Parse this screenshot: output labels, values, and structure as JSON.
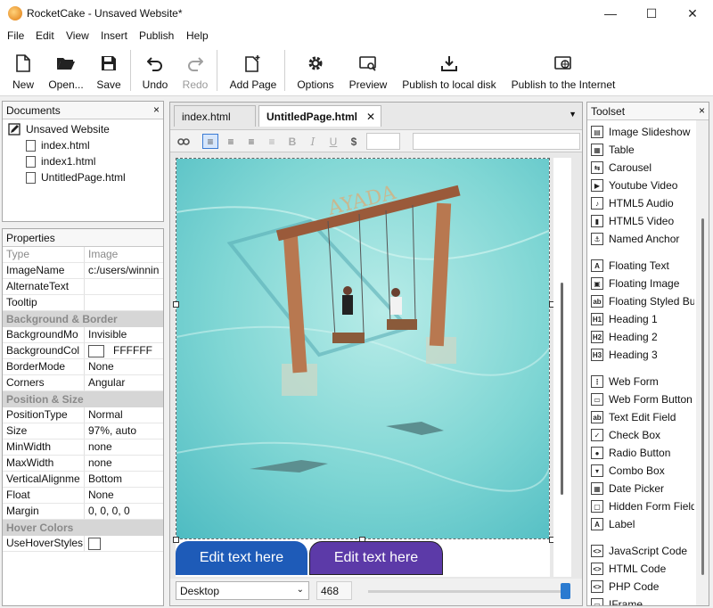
{
  "window": {
    "title": "RocketCake - Unsaved Website*",
    "minimize": "—",
    "maximize": "☐",
    "close": "✕"
  },
  "menu": [
    "File",
    "Edit",
    "View",
    "Insert",
    "Publish",
    "Help"
  ],
  "toolbar": {
    "new": "New",
    "open": "Open...",
    "save": "Save",
    "undo": "Undo",
    "redo": "Redo",
    "add_page": "Add Page",
    "options": "Options",
    "preview": "Preview",
    "publish_local": "Publish to local disk",
    "publish_internet": "Publish to the Internet"
  },
  "documents": {
    "title": "Documents",
    "close": "×",
    "root": "Unsaved Website",
    "files": [
      "index.html",
      "index1.html",
      "UntitledPage.html"
    ]
  },
  "properties": {
    "title": "Properties",
    "header": {
      "name": "Type",
      "value": "Image"
    },
    "rows": [
      {
        "kind": "prop",
        "name": "ImageName",
        "value": "c:/users/winnin"
      },
      {
        "kind": "prop",
        "name": "AlternateText",
        "value": ""
      },
      {
        "kind": "prop",
        "name": "Tooltip",
        "value": ""
      },
      {
        "kind": "cat",
        "name": "Background & Border"
      },
      {
        "kind": "prop",
        "name": "BackgroundMo",
        "value": "Invisible"
      },
      {
        "kind": "prop",
        "name": "BackgroundCol",
        "value": "FFFFFF",
        "swatch": "#ffffff"
      },
      {
        "kind": "prop",
        "name": "BorderMode",
        "value": "None"
      },
      {
        "kind": "prop",
        "name": "Corners",
        "value": "Angular"
      },
      {
        "kind": "cat",
        "name": "Position & Size"
      },
      {
        "kind": "prop",
        "name": "PositionType",
        "value": "Normal"
      },
      {
        "kind": "prop",
        "name": "Size",
        "value": "97%, auto"
      },
      {
        "kind": "prop",
        "name": "MinWidth",
        "value": "none"
      },
      {
        "kind": "prop",
        "name": "MaxWidth",
        "value": "none"
      },
      {
        "kind": "prop",
        "name": "VerticalAlignme",
        "value": "Bottom"
      },
      {
        "kind": "prop",
        "name": "Float",
        "value": "None"
      },
      {
        "kind": "prop",
        "name": "Margin",
        "value": "0, 0, 0, 0"
      },
      {
        "kind": "cat",
        "name": "Hover Colors"
      },
      {
        "kind": "prop",
        "name": "UseHoverStyles",
        "value": "",
        "checkbox": true
      }
    ]
  },
  "editor": {
    "tabs": [
      {
        "label": "index.html",
        "active": false
      },
      {
        "label": "UntitledPage.html",
        "active": true
      }
    ],
    "tab_close": "✕",
    "image_sign": "AYADA",
    "button1": "Edit text here",
    "button2": "Edit text here",
    "device": "Desktop",
    "width_value": "468",
    "colors": {
      "button1": "#1e5bb8",
      "button2": "#5c3aa8"
    }
  },
  "toolset": {
    "title": "Toolset",
    "close": "×",
    "groups": [
      [
        {
          "label": "Image Slideshow",
          "icon": "slideshow-icon"
        },
        {
          "label": "Table",
          "icon": "table-icon"
        },
        {
          "label": "Carousel",
          "icon": "carousel-icon"
        },
        {
          "label": "Youtube Video",
          "icon": "youtube-icon"
        },
        {
          "label": "HTML5 Audio",
          "icon": "audio-icon"
        },
        {
          "label": "HTML5 Video",
          "icon": "video-icon"
        },
        {
          "label": "Named Anchor",
          "icon": "anchor-icon"
        }
      ],
      [
        {
          "label": "Floating Text",
          "icon": "text-icon"
        },
        {
          "label": "Floating Image",
          "icon": "image-icon"
        },
        {
          "label": "Floating Styled But",
          "icon": "styled-button-icon"
        },
        {
          "label": "Heading 1",
          "icon": "h1-icon"
        },
        {
          "label": "Heading 2",
          "icon": "h2-icon"
        },
        {
          "label": "Heading 3",
          "icon": "h3-icon"
        }
      ],
      [
        {
          "label": "Web Form",
          "icon": "form-icon"
        },
        {
          "label": "Web Form Button",
          "icon": "form-button-icon"
        },
        {
          "label": "Text Edit Field",
          "icon": "text-field-icon"
        },
        {
          "label": "Check Box",
          "icon": "checkbox-icon"
        },
        {
          "label": "Radio Button",
          "icon": "radio-icon"
        },
        {
          "label": "Combo Box",
          "icon": "combobox-icon"
        },
        {
          "label": "Date Picker",
          "icon": "date-picker-icon"
        },
        {
          "label": "Hidden Form Field",
          "icon": "hidden-field-icon"
        },
        {
          "label": "Label",
          "icon": "label-icon"
        }
      ],
      [
        {
          "label": "JavaScript Code",
          "icon": "js-icon"
        },
        {
          "label": "HTML Code",
          "icon": "html-icon"
        },
        {
          "label": "PHP Code",
          "icon": "php-icon"
        },
        {
          "label": "IFrame",
          "icon": "iframe-icon"
        }
      ]
    ]
  }
}
